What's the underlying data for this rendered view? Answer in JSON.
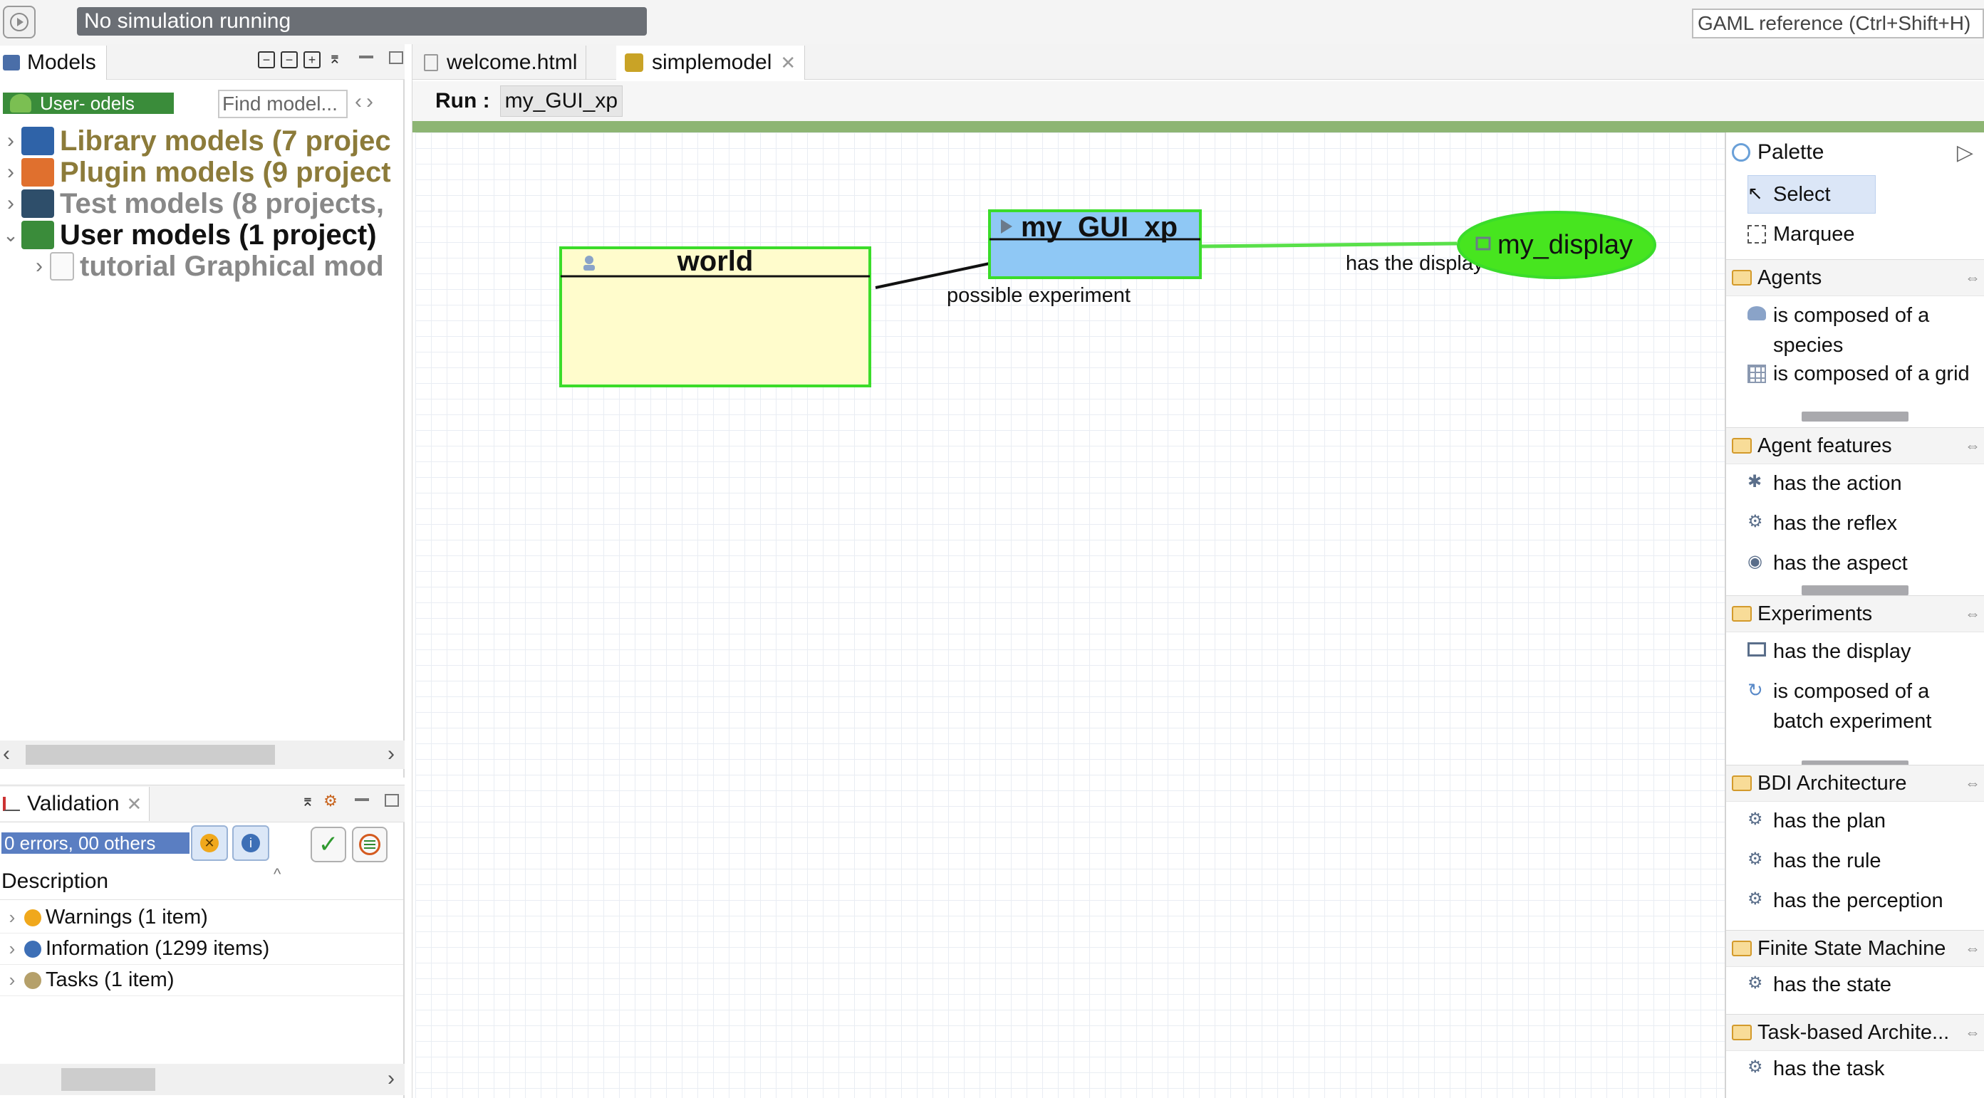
{
  "topbar": {
    "simulation_status": "No simulation running",
    "gaml_reference": "GAML reference (Ctrl+Shift+H)"
  },
  "models_panel": {
    "tab_label": "Models",
    "filter_label": "User-  odels",
    "find_placeholder": "Find model...",
    "tree": [
      {
        "label": "Library models (7 projec",
        "icon": "library-icon",
        "expanded": false
      },
      {
        "label": "Plugin models (9 project",
        "icon": "plugin-icon",
        "expanded": false
      },
      {
        "label": "Test models (8 projects, ",
        "icon": "test-icon",
        "expanded": false
      },
      {
        "label": "User models (1 project)",
        "icon": "user-models-icon",
        "expanded": true
      },
      {
        "label": "tutorial Graphical mod",
        "icon": "folder-icon",
        "expanded": false
      }
    ]
  },
  "validation_panel": {
    "tab_label": "Validation",
    "counts": "0 errors,  00 others",
    "description_header": "Description",
    "rows": [
      {
        "label": "Warnings (1 item)",
        "color": "#f0a81c"
      },
      {
        "label": "Information (1299 items)",
        "color": "#3d6fb6"
      },
      {
        "label": "Tasks (1 item)",
        "color": "#b5a06a"
      }
    ]
  },
  "editor": {
    "tabs": [
      {
        "label": "welcome.html",
        "active": false
      },
      {
        "label": "simplemodel",
        "active": true
      }
    ],
    "run_label": "Run :",
    "run_value": "my_GUI_xp"
  },
  "diagram": {
    "nodes": {
      "world": "world",
      "experiment": "my_GUI_xp",
      "display": "my_display"
    },
    "edges": {
      "possible_experiment": "possible experiment",
      "has_display": "has the display"
    },
    "colors": {
      "world_fill": "#fffccc",
      "experiment_fill": "#8fc8f5",
      "display_fill": "#47e51f",
      "border": "#3bdc2a"
    }
  },
  "palette": {
    "title": "Palette",
    "tools": [
      "Select",
      "Marquee"
    ],
    "groups": [
      {
        "title": "Agents",
        "items": [
          "is composed of a species",
          "is composed of a grid"
        ]
      },
      {
        "title": "Agent features",
        "items": [
          "has the action",
          "has the reflex",
          "has the aspect"
        ]
      },
      {
        "title": "Experiments",
        "items": [
          "has the display",
          "is composed of a batch experiment"
        ]
      },
      {
        "title": "BDI Architecture",
        "items": [
          "has the plan",
          "has the rule",
          "has the perception"
        ]
      },
      {
        "title": "Finite State Machine",
        "items": [
          "has the state"
        ]
      },
      {
        "title": "Task-based Archite...",
        "items": [
          "has the task"
        ]
      }
    ]
  }
}
